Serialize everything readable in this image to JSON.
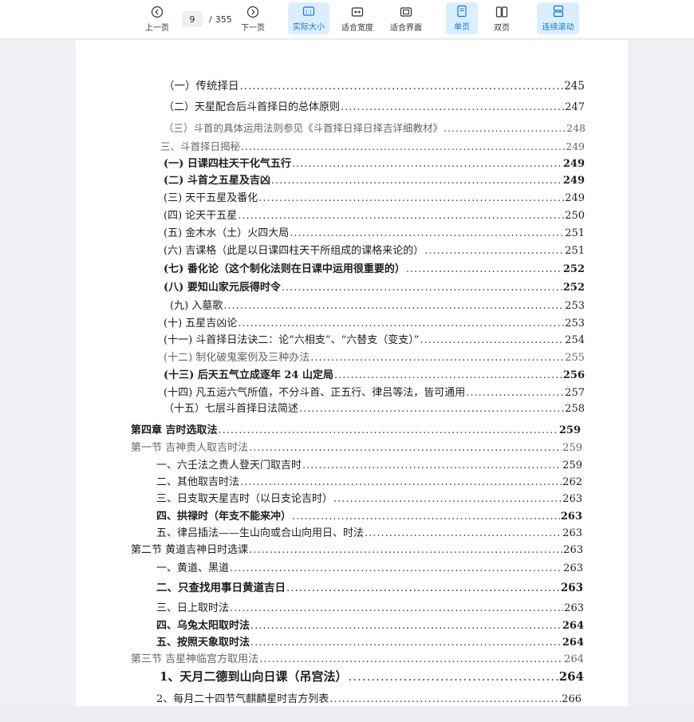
{
  "toolbar": {
    "prev_label": "上一页",
    "next_label": "下一页",
    "current_page": "9",
    "page_sep": "/",
    "total_pages": "355",
    "actual_size_label": "实际大小",
    "fit_width_label": "适合宽度",
    "fit_page_label": "适合界面",
    "single_page_label": "单页",
    "double_page_label": "双页",
    "continuous_label": "连续滚动",
    "colors": {
      "active_bg": "#dbeeff",
      "active_fg": "#1976d2"
    }
  },
  "toc": [
    {
      "title": "（一）传统择日",
      "page": "245"
    },
    {
      "title": "（二）天星配合后斗首择日的总体原则",
      "page": "247"
    },
    {
      "title": "（三）斗首的具体运用法则参见《斗首择日择日择吉详细教材》",
      "page": "248"
    },
    {
      "title": "三、斗首择日揭秘",
      "page": "249"
    },
    {
      "title": "(一) 日课四柱天干化气五行",
      "page": "249"
    },
    {
      "title": "(二) 斗首之五星及吉凶",
      "page": "249"
    },
    {
      "title": "(三) 天干五星及番化",
      "page": "249"
    },
    {
      "title": "(四) 论天干五星",
      "page": "250"
    },
    {
      "title": "(五) 金木水（土）火四大局",
      "page": "251"
    },
    {
      "title": "(六) 吉课格（此是以日课四柱天干所组成的课格来论的）",
      "page": "251"
    },
    {
      "title": "(七) 番化论（这个制化法则在日课中运用很重要的）",
      "page": "252"
    },
    {
      "title": "(八) 要知山家元辰得时令",
      "page": "252"
    },
    {
      "title": "(九) 入墓歌",
      "page": "253"
    },
    {
      "title": "(十) 五星吉凶论",
      "page": "253"
    },
    {
      "title": "(十一) 斗首择日法诀二：论“六相支”、“六替支（变支）”",
      "page": "254"
    },
    {
      "title": "(十二) 制化破鬼案例及三种办法",
      "page": "255"
    },
    {
      "title": "(十三) 后天五气立成逐年 24 山定局",
      "page": "256"
    },
    {
      "title": "(十四) 凡五运六气所值，不分斗首、正五行、律吕等法，皆可通用",
      "page": "257"
    },
    {
      "title": "（十五）七层斗首择日法简述",
      "page": "258"
    },
    {
      "title": "第四章 吉时选取法",
      "page": "259"
    },
    {
      "title": "第一节 吉神贵人取吉时法",
      "page": "259"
    },
    {
      "title": "一、六壬法之贵人登天门取吉时",
      "page": "259"
    },
    {
      "title": "二、其他取吉时法",
      "page": "262"
    },
    {
      "title": "三、日支取天星吉时（以日支论吉时）",
      "page": "263"
    },
    {
      "title": "四、拱禄时（年支不能来冲）",
      "page": "263"
    },
    {
      "title": "五、律吕插法——生山向或合山向用日、时法",
      "page": "263"
    },
    {
      "title": "第二节 黄道吉神日时选课",
      "page": "263"
    },
    {
      "title": "一、黄道、黑道",
      "page": "263"
    },
    {
      "title": "二、只查找用事日黄道吉日",
      "page": "263"
    },
    {
      "title": "三、日上取时法",
      "page": "263"
    },
    {
      "title": "四、乌兔太阳取时法",
      "page": "264"
    },
    {
      "title": "五、按照天象取时法",
      "page": "264"
    },
    {
      "title": "第三节 吉星神临宫方取用法",
      "page": "264"
    },
    {
      "title": "1、天月二德到山向日课（吊宫法）",
      "page": "264"
    },
    {
      "title": "2、每月二十四节气麒麟星时吉方列表",
      "page": "266"
    }
  ]
}
